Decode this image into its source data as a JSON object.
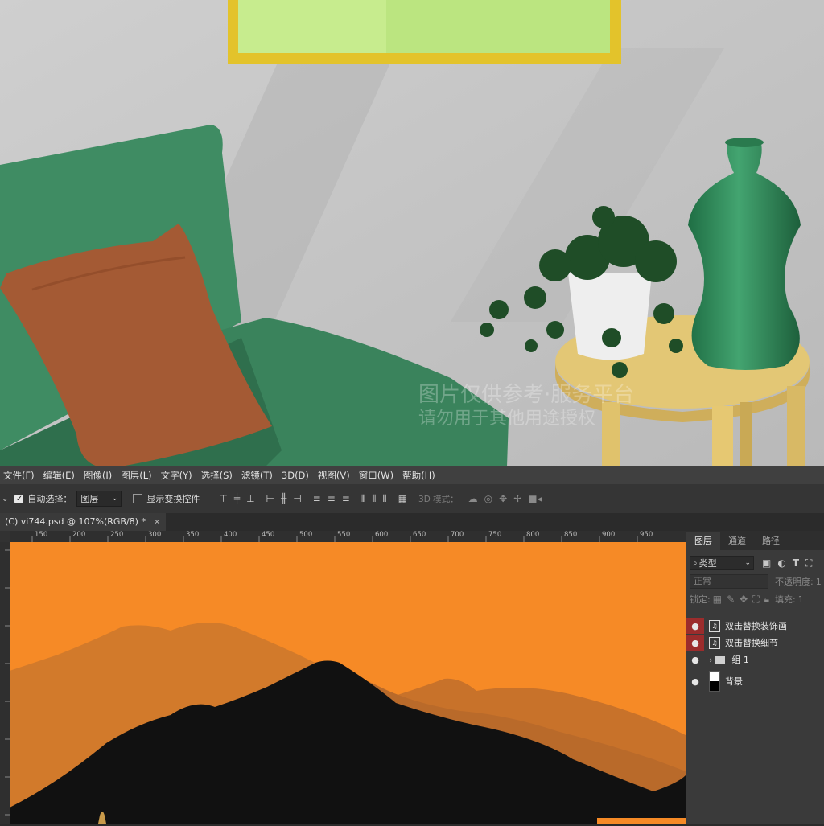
{
  "scene": {
    "watermark_line1": "图片仅供参考·服务平台",
    "watermark_line2": "请勿用于其他用途授权"
  },
  "menu": [
    "文件(F)",
    "编辑(E)",
    "图像(I)",
    "图层(L)",
    "文字(Y)",
    "选择(S)",
    "滤镜(T)",
    "3D(D)",
    "视图(V)",
    "窗口(W)",
    "帮助(H)"
  ],
  "options": {
    "auto_select_label": "自动选择：",
    "auto_select_checked": true,
    "layer_dropdown": "图层",
    "show_transform_label": "显示变换控件",
    "mode_3d_label": "3D 模式："
  },
  "document": {
    "tab_title": "(C) vi744.psd @ 107%(RGB/8) *",
    "close": "×"
  },
  "ruler_h": [
    "150",
    "200",
    "250",
    "300",
    "350",
    "400",
    "450",
    "500",
    "550",
    "600",
    "650",
    "700",
    "750",
    "800",
    "850",
    "900",
    "950"
  ],
  "layers_panel": {
    "tabs": [
      "图层",
      "通道",
      "路径"
    ],
    "filter_label": "类型",
    "blend_mode": "正常",
    "opacity_label": "不透明度:",
    "opacity_value": "1",
    "lock_label": "锁定:",
    "fill_label": "填充:",
    "fill_value": "1",
    "layers": [
      {
        "name": "双击替换装饰画",
        "highlight": true
      },
      {
        "name": "双击替换细节",
        "highlight": true
      },
      {
        "name": "组 1",
        "highlight": false
      },
      {
        "name": "背景",
        "highlight": false
      }
    ]
  },
  "colors": {
    "wall": "#c9c9c9",
    "armchair": "#3d8a62",
    "pillow": "#a45a34",
    "table": "#e3c775",
    "vase": "#2f8a57",
    "sky": "#f68a26",
    "layer_highlight": "#9b2c2c",
    "frame": "#e3c32b"
  }
}
